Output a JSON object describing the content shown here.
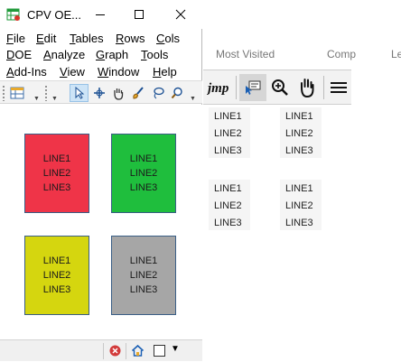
{
  "window": {
    "title": "CPV OE...",
    "menus": [
      {
        "label": "File",
        "u": "F",
        "rest": "ile"
      },
      {
        "label": "Edit",
        "u": "E",
        "rest": "dit"
      },
      {
        "label": "Tables",
        "u": "T",
        "rest": "ables"
      },
      {
        "label": "Rows",
        "u": "R",
        "rest": "ows"
      },
      {
        "label": "Cols",
        "u": "C",
        "rest": "ols"
      },
      {
        "label": "DOE",
        "u": "D",
        "rest": "OE"
      },
      {
        "label": "Analyze",
        "u": "A",
        "rest": "nalyze"
      },
      {
        "label": "Graph",
        "u": "G",
        "rest": "raph"
      },
      {
        "label": "Tools",
        "u": "T",
        "rest": "ools"
      },
      {
        "label": "Add-Ins",
        "u": "A",
        "rest": "dd-Ins"
      },
      {
        "label": "View",
        "u": "V",
        "rest": "iew"
      },
      {
        "label": "Window",
        "u": "W",
        "rest": "indow"
      },
      {
        "label": "Help",
        "u": "H",
        "rest": "elp"
      }
    ],
    "boxes": [
      {
        "lines": [
          "LINE1",
          "LINE2",
          "LINE3"
        ],
        "color": "#ef3448"
      },
      {
        "lines": [
          "LINE1",
          "LINE2",
          "LINE3"
        ],
        "color": "#1fbe3d"
      },
      {
        "lines": [
          "LINE1",
          "LINE2",
          "LINE3"
        ],
        "color": "#d5d60f"
      },
      {
        "lines": [
          "LINE1",
          "LINE2",
          "LINE3"
        ],
        "color": "#a6a6a6"
      }
    ]
  },
  "background_browser": {
    "bookmarks": [
      "Most Visited",
      "Comp",
      "Le"
    ]
  },
  "jmp_panel": {
    "logo": "jmp"
  },
  "text_columns": {
    "group1": {
      "col1": [
        "LINE1",
        "LINE2",
        "LINE3"
      ],
      "col2": [
        "LINE1",
        "LINE2",
        "LINE3"
      ]
    },
    "group2": {
      "col1": [
        "LINE1",
        "LINE2",
        "LINE3"
      ],
      "col2": [
        "LINE1",
        "LINE2",
        "LINE3"
      ]
    }
  },
  "colors": {
    "selected_tool": "#cde4f7",
    "accent": "#0a64c8"
  }
}
